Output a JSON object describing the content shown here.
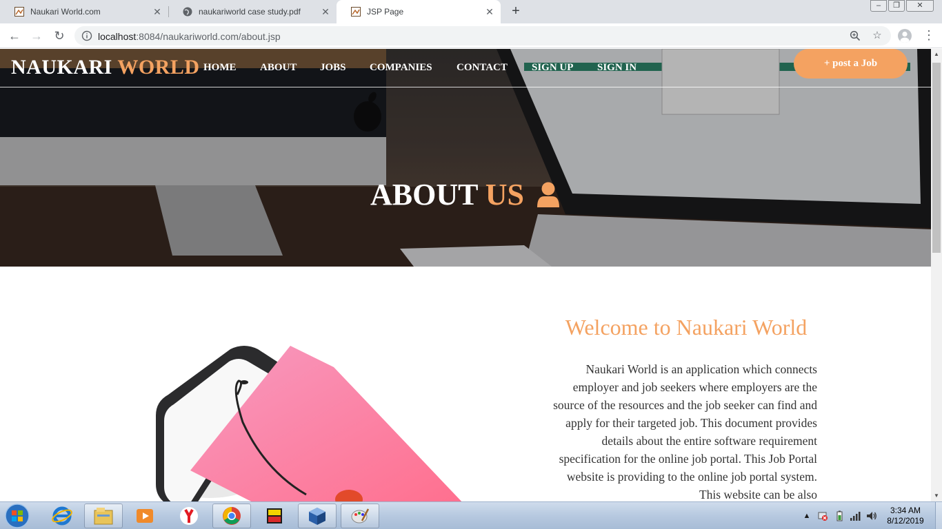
{
  "browser": {
    "tabs": [
      {
        "title": "Naukari World.com",
        "icon": "page-icon",
        "active": false
      },
      {
        "title": "naukariworld case study.pdf",
        "icon": "globe-icon",
        "active": false
      },
      {
        "title": "JSP Page",
        "icon": "page-icon",
        "active": true
      }
    ],
    "address": {
      "host": "localhost",
      "rest": ":8084/naukariworld.com/about.jsp"
    }
  },
  "site": {
    "brand": {
      "part1": "NAUKARI",
      "part2": "WORLD"
    },
    "nav": [
      {
        "label": "HOME"
      },
      {
        "label": "ABOUT"
      },
      {
        "label": "JOBS"
      },
      {
        "label": "COMPANIES"
      },
      {
        "label": "CONTACT"
      },
      {
        "label": "SIGN UP"
      },
      {
        "label": "SIGN IN"
      }
    ],
    "post_job": "+ post a Job",
    "hero": {
      "title_part1": "ABOUT",
      "title_part2": "US"
    },
    "welcome": "Welcome to Naukari World",
    "about_text": "Naukari World is an application which connects employer and job seekers where employers are the source of the resources and the job seeker can find and apply for their targeted job. This document provides details about the entire software requirement specification for the online job portal. This Job Portal website is providing to the online job portal system. This website can be also"
  },
  "taskbar": {
    "time": "3:34 AM",
    "date": "8/12/2019",
    "apps": [
      "ie-icon",
      "explorer-icon",
      "media-player-icon",
      "yandex-icon",
      "chrome-icon",
      "msdos-icon",
      "virtualbox-icon",
      "paint-icon"
    ]
  },
  "colors": {
    "accent": "#f4a261",
    "chrome_tabstrip": "#dee1e6"
  }
}
